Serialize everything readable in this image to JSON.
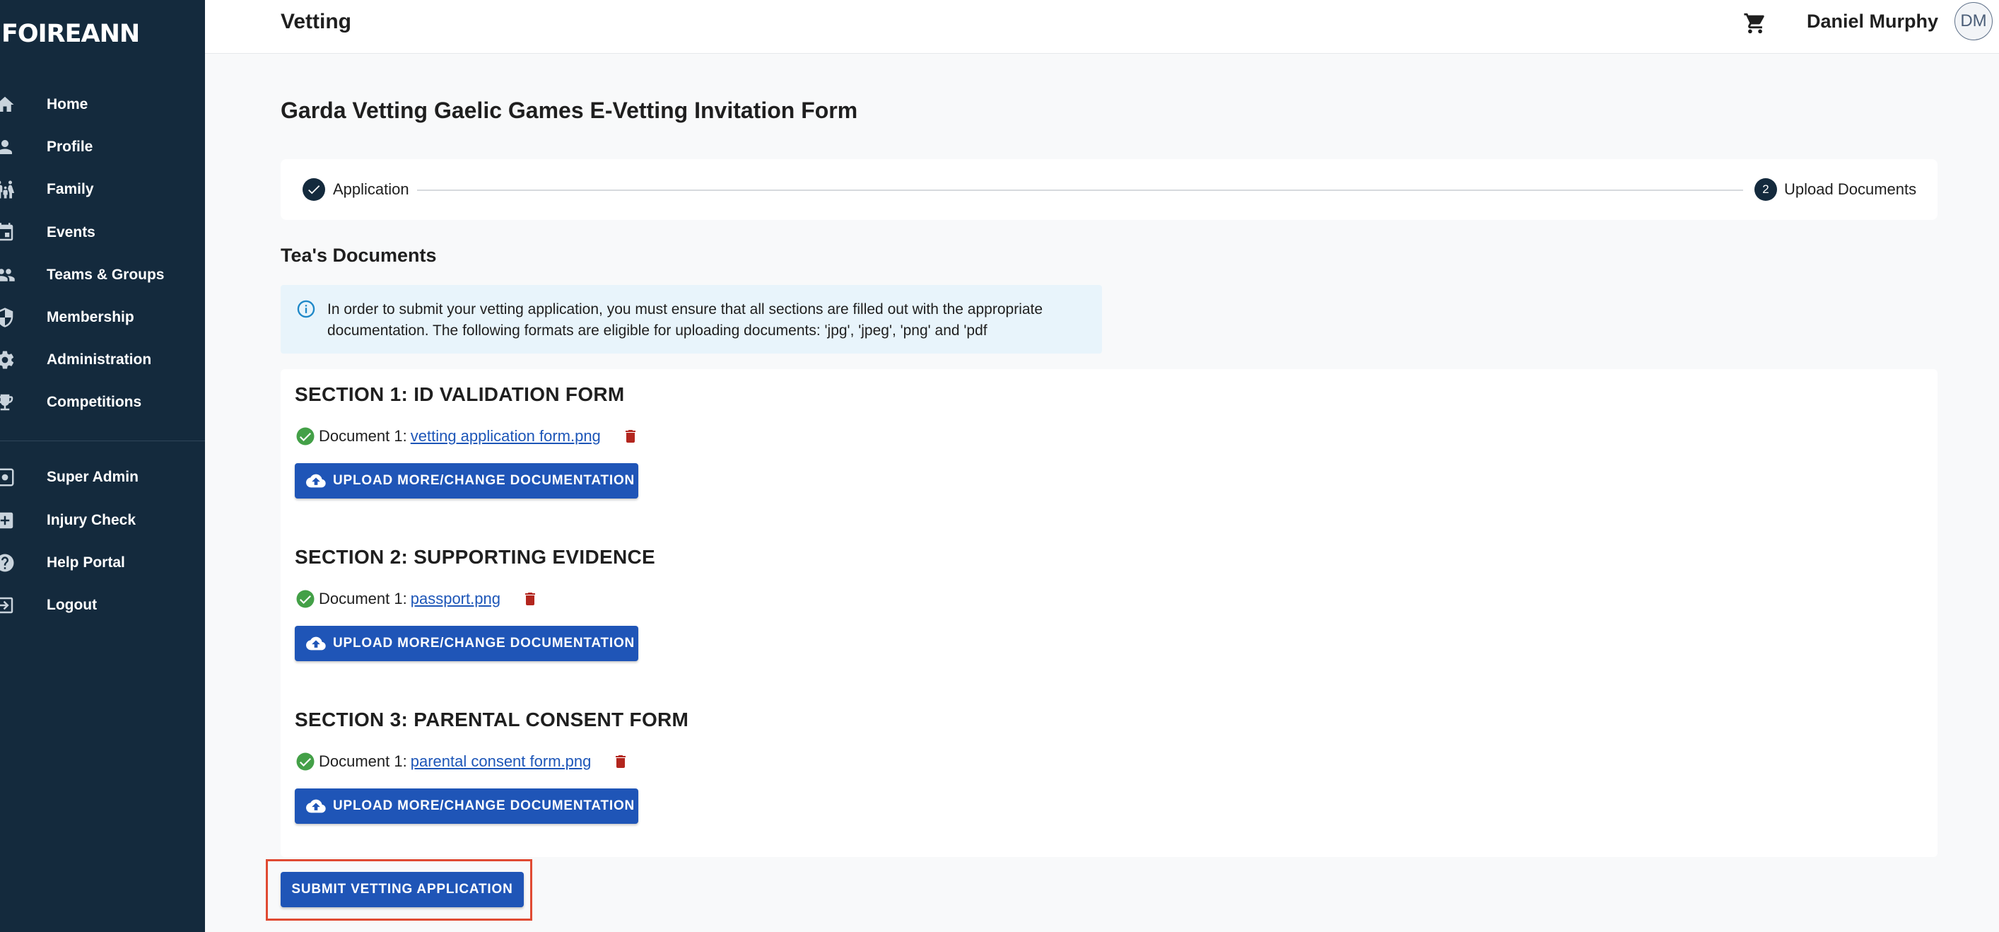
{
  "brand": {
    "logo_text": "FOIREANN"
  },
  "sidebar": {
    "items": [
      {
        "label": "Home",
        "icon": "home-icon"
      },
      {
        "label": "Profile",
        "icon": "person-icon"
      },
      {
        "label": "Family",
        "icon": "family-icon"
      },
      {
        "label": "Events",
        "icon": "calendar-icon"
      },
      {
        "label": "Teams & Groups",
        "icon": "group-icon"
      },
      {
        "label": "Membership",
        "icon": "shield-icon"
      },
      {
        "label": "Administration",
        "icon": "gear-icon"
      },
      {
        "label": "Competitions",
        "icon": "trophy-icon"
      }
    ],
    "secondary_items": [
      {
        "label": "Super Admin",
        "icon": "admin-gear-icon"
      },
      {
        "label": "Injury Check",
        "icon": "medical-plus-icon"
      },
      {
        "label": "Help Portal",
        "icon": "help-icon"
      },
      {
        "label": "Logout",
        "icon": "logout-icon"
      }
    ]
  },
  "header": {
    "title": "Vetting",
    "user_name": "Daniel Murphy",
    "avatar_initials": "DM"
  },
  "main": {
    "form_title": "Garda Vetting Gaelic Games E-Vetting Invitation Form",
    "stepper": {
      "step1_label": "Application",
      "step2_number": "2",
      "step2_label": "Upload Documents"
    },
    "documents_title": "Tea's Documents",
    "info_text": "In order to submit your vetting application, you must ensure that all sections are filled out with the appropriate documentation. The following formats are eligible for uploading documents: 'jpg', 'jpeg', 'png' and 'pdf",
    "sections": [
      {
        "title": "SECTION 1: ID VALIDATION FORM",
        "doc_prefix": "Document 1:",
        "doc_name": "vetting application form.png",
        "button_label": "UPLOAD MORE/CHANGE DOCUMENTATION"
      },
      {
        "title": "SECTION 2: SUPPORTING EVIDENCE",
        "doc_prefix": "Document 1:",
        "doc_name": "passport.png",
        "button_label": "UPLOAD MORE/CHANGE DOCUMENTATION"
      },
      {
        "title": "SECTION 3: PARENTAL CONSENT FORM",
        "doc_prefix": "Document 1:",
        "doc_name": "parental consent form.png",
        "button_label": "UPLOAD MORE/CHANGE DOCUMENTATION"
      }
    ],
    "submit_label": "SUBMIT VETTING APPLICATION"
  },
  "colors": {
    "sidebar_bg": "#142a3d",
    "primary_button": "#1f55b7",
    "link": "#1d56b8",
    "success": "#43a047",
    "delete": "#b3261e",
    "highlight": "#e04a32",
    "info_bg": "#e8f4fb"
  }
}
